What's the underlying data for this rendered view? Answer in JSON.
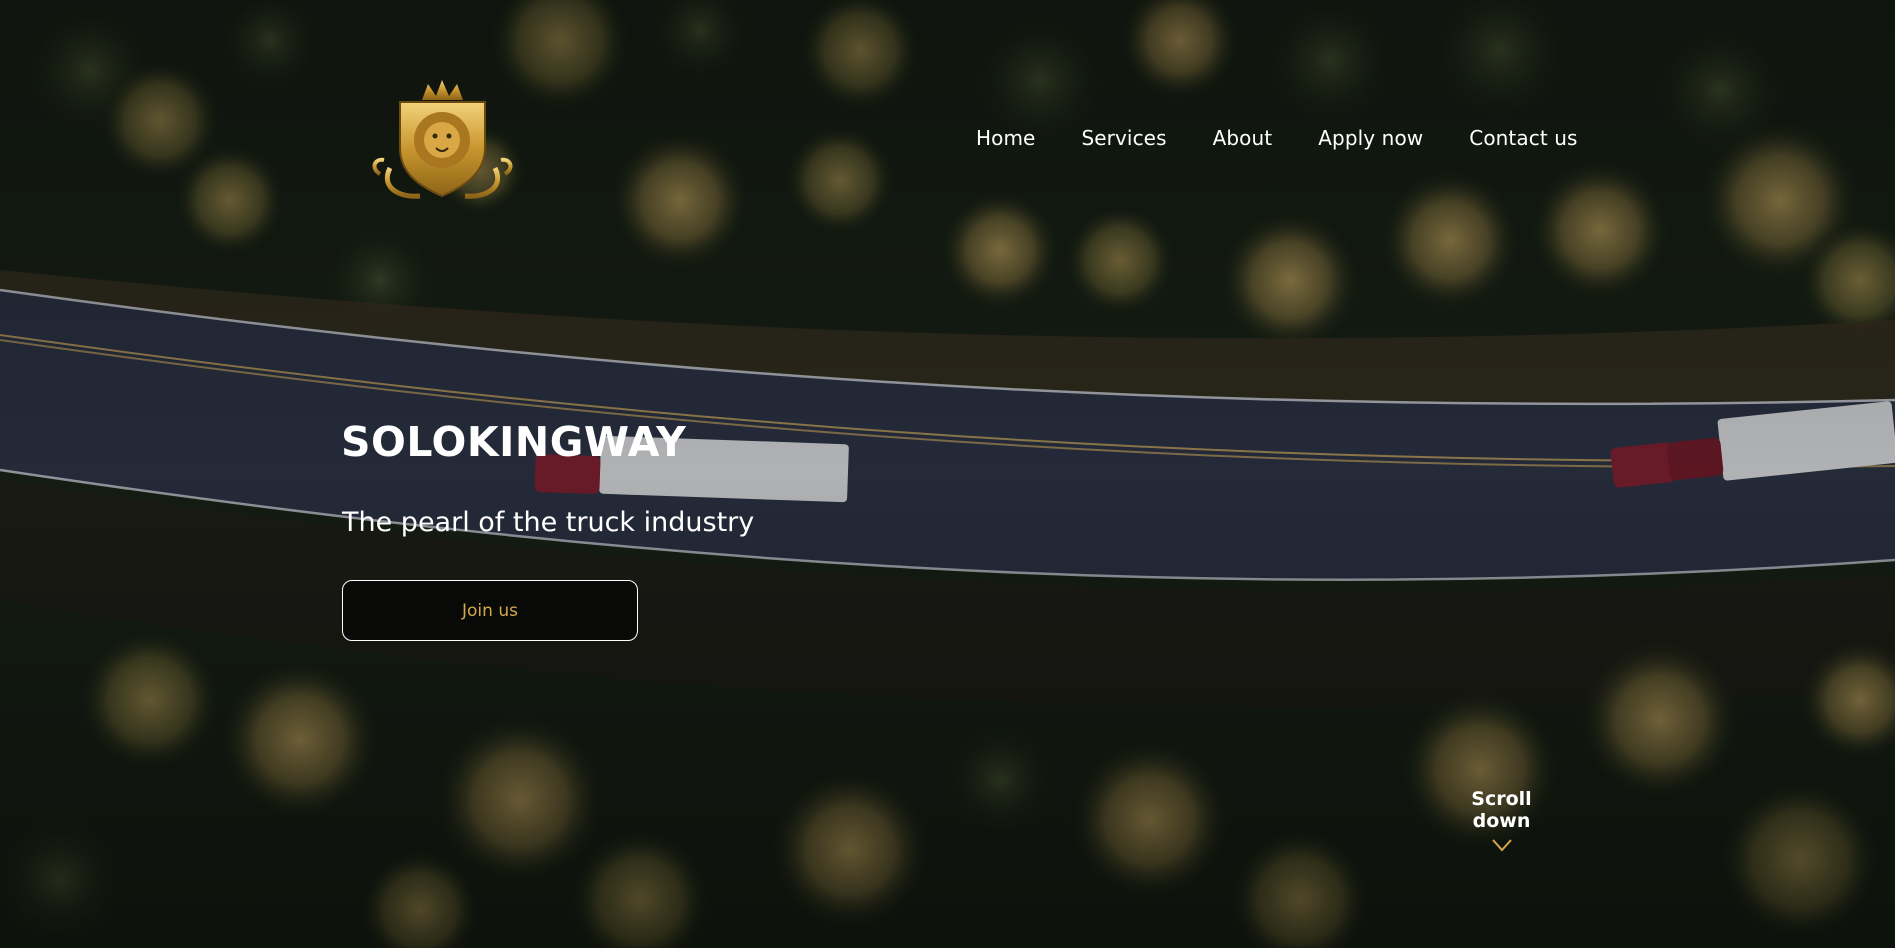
{
  "brand": {
    "logo_icon": "lion-crest-icon",
    "accent_color": "#d4a94a"
  },
  "nav": {
    "items": [
      {
        "label": "Home"
      },
      {
        "label": "Services"
      },
      {
        "label": "About"
      },
      {
        "label": "Apply now"
      },
      {
        "label": "Contact us"
      }
    ]
  },
  "hero": {
    "title": "SOLOKINGWAY",
    "subtitle": "The pearl of the truck industry",
    "cta_label": "Join us"
  },
  "scroll": {
    "label": "Scroll down",
    "icon": "chevron-down-icon"
  }
}
